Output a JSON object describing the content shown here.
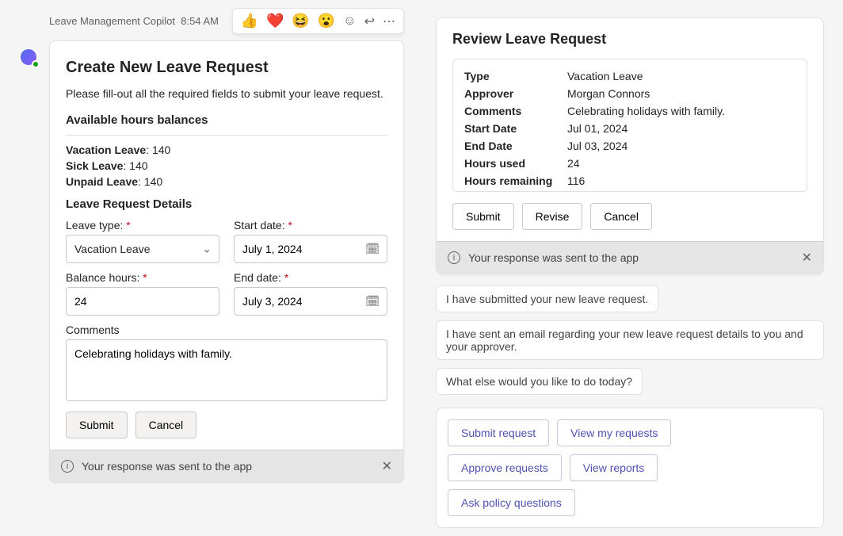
{
  "left": {
    "bot_name": "Leave Management Copilot",
    "timestamp": "8:54 AM",
    "reactions": [
      "👍",
      "❤️",
      "😆",
      "😮"
    ],
    "card": {
      "title": "Create New Leave Request",
      "intro": "Please fill-out all the required fields to submit your leave request.",
      "balances_label": "Available hours balances",
      "balances": [
        {
          "name": "Vacation Leave",
          "hours": "140"
        },
        {
          "name": "Sick Leave",
          "hours": "140"
        },
        {
          "name": "Unpaid Leave",
          "hours": "140"
        }
      ],
      "details_label": "Leave Request Details",
      "leave_type_label": "Leave type:",
      "leave_type_value": "Vacation Leave",
      "start_date_label": "Start date:",
      "start_date_value": "July 1, 2024",
      "balance_hours_label": "Balance hours:",
      "balance_hours_value": "24",
      "end_date_label": "End date:",
      "end_date_value": "July 3, 2024",
      "comments_label": "Comments",
      "comments_value": "Celebrating holidays with family.",
      "submit_label": "Submit",
      "cancel_label": "Cancel",
      "toast": "Your response was sent to the app"
    }
  },
  "right": {
    "review": {
      "title": "Review Leave Request",
      "rows": [
        {
          "k": "Type",
          "v": "Vacation Leave"
        },
        {
          "k": "Approver",
          "v": "Morgan Connors"
        },
        {
          "k": "Comments",
          "v": "Celebrating holidays with family."
        },
        {
          "k": "Start Date",
          "v": "Jul 01, 2024"
        },
        {
          "k": "End Date",
          "v": "Jul 03, 2024"
        },
        {
          "k": "Hours used",
          "v": "24"
        },
        {
          "k": "Hours remaining",
          "v": "116"
        }
      ],
      "submit_label": "Submit",
      "revise_label": "Revise",
      "cancel_label": "Cancel",
      "toast": "Your response was sent to the app"
    },
    "messages": [
      "I have submitted your new leave request.",
      "I have sent an email regarding your new leave request details to you and your approver.",
      "What else would you like to do today?"
    ],
    "actions": [
      "Submit request",
      "View my requests",
      "Approve requests",
      "View reports",
      "Ask policy questions"
    ]
  }
}
